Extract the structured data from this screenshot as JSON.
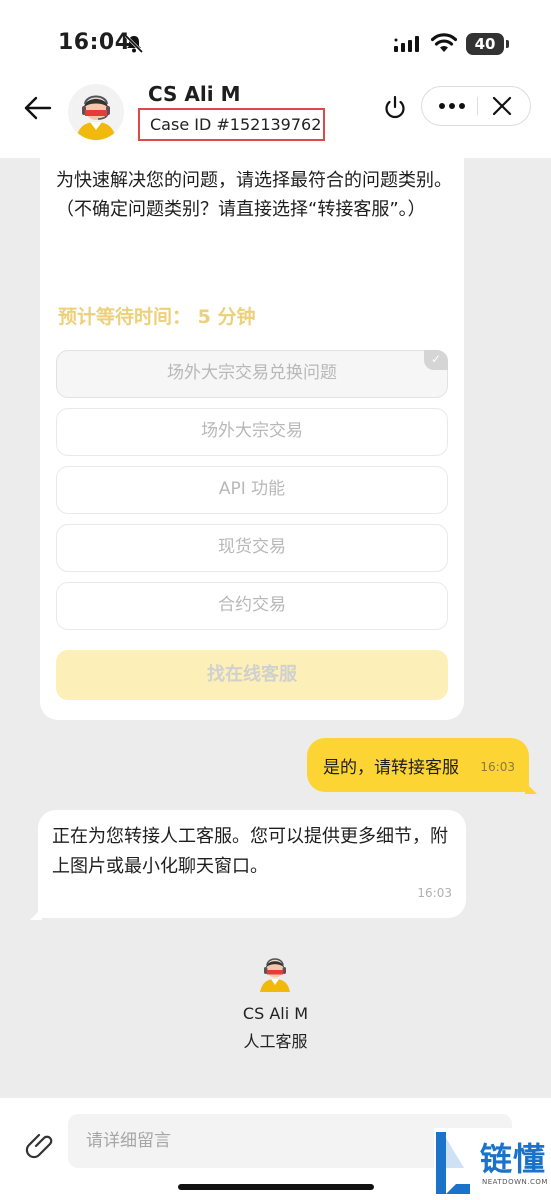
{
  "status_bar": {
    "time": "16:04",
    "battery": "40"
  },
  "header": {
    "agent_name": "CS Ali M",
    "case_id": "Case ID #152139762"
  },
  "bot_message": {
    "lines": [
      "为快速解决您的问题，请选择最符合的问题类别。",
      "（不确定问题类别？请直接选择“转接客服”。）"
    ],
    "wait_time": "预计等待时间： 5 分钟",
    "options": [
      {
        "label": "场外大宗交易兑换问题",
        "selected": true
      },
      {
        "label": "场外大宗交易",
        "selected": false
      },
      {
        "label": "API 功能",
        "selected": false
      },
      {
        "label": "现货交易",
        "selected": false
      },
      {
        "label": "合约交易",
        "selected": false
      }
    ],
    "find_agent_label": "找在线客服"
  },
  "user_message": {
    "text": "是的，请转接客服",
    "time": "16:03"
  },
  "agent_message": {
    "text": "正在为您转接人工客服。您可以提供更多细节，附上图片或最小化聊天窗口。",
    "time": "16:03"
  },
  "agent_joined": {
    "name": "CS Ali M",
    "role": "人工客服"
  },
  "input": {
    "placeholder": "请详细留言"
  },
  "watermark": {
    "text": "链懂",
    "sub": "NEATDOWN.COM"
  },
  "colors": {
    "accent_yellow": "#fcd535",
    "wait_time_text": "#edd07a",
    "background": "#ececec",
    "highlight_box": "#e04848"
  }
}
